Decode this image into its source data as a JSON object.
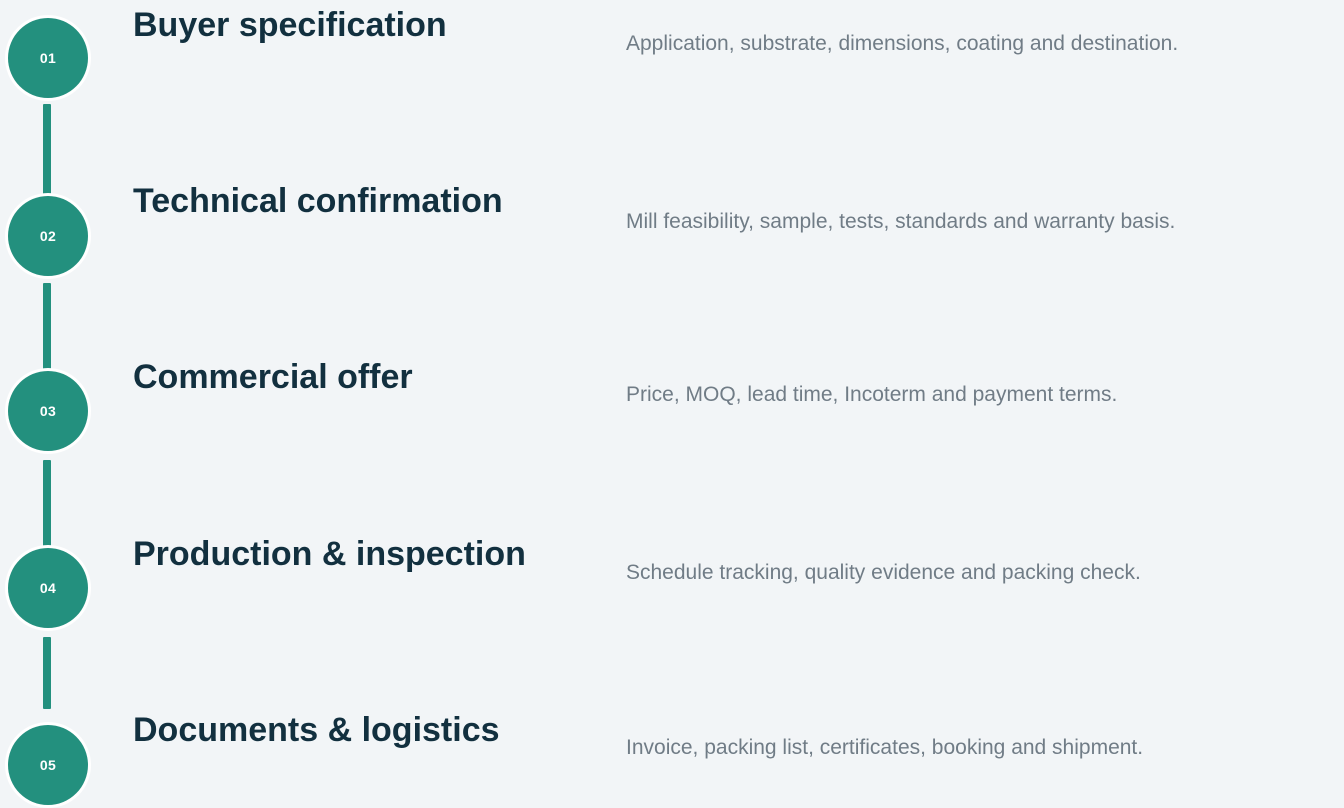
{
  "steps": [
    {
      "number": "01",
      "title": "Buyer specification",
      "description": "Application, substrate, dimensions, coating and destination."
    },
    {
      "number": "02",
      "title": "Technical confirmation",
      "description": "Mill feasibility, sample, tests, standards and warranty basis."
    },
    {
      "number": "03",
      "title": "Commercial offer",
      "description": "Price, MOQ, lead time, Incoterm and payment terms."
    },
    {
      "number": "04",
      "title": "Production & inspection",
      "description": "Schedule tracking, quality evidence and packing check."
    },
    {
      "number": "05",
      "title": "Documents & logistics",
      "description": "Invoice, packing list, certificates, booking and shipment."
    }
  ],
  "colors": {
    "accent": "#23907e",
    "title": "#12303f",
    "description": "#707c86",
    "background": "#f2f5f7"
  }
}
